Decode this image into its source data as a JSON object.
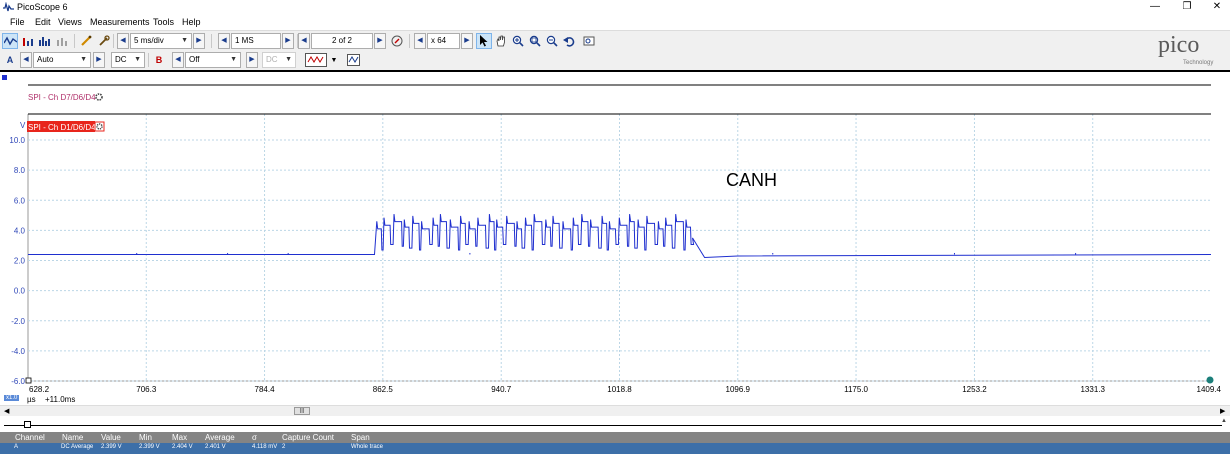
{
  "window": {
    "title": "PicoScope 6",
    "controls": {
      "minimize": "—",
      "maximize": "❐",
      "close": "✕"
    }
  },
  "menu": [
    "File",
    "Edit",
    "Views",
    "Measurements",
    "Tools",
    "Help"
  ],
  "toolbar1": {
    "timebase": "5 ms/div",
    "samples": "1 MS",
    "capture": "2 of 2",
    "zoom": "x 64"
  },
  "toolbar2": {
    "channel_a_label": "A",
    "range_a": "Auto",
    "coupling_a": "DC",
    "channel_b_label": "B",
    "range_b": "Off",
    "coupling_b": "DC"
  },
  "logo": {
    "main": "pico",
    "sub": "Technology"
  },
  "plot": {
    "decode_top_label": "SPI - Ch D7/D6/D4",
    "decode_bottom_label": "SPI - Ch D1/D6/D4",
    "y_unit": "V",
    "y_ticks": [
      "10.0",
      "8.0",
      "6.0",
      "4.0",
      "2.0",
      "0.0",
      "-2.0",
      "-4.0",
      "-6.0"
    ],
    "x_ticks": [
      "628.2",
      "706.3",
      "784.4",
      "862.5",
      "940.7",
      "1018.8",
      "1096.9",
      "1175.0",
      "1253.2",
      "1331.3",
      "1409.4"
    ],
    "annotation": "CANH",
    "trace_color": "#1f2fcf"
  },
  "status": {
    "scale": "x1.0",
    "unit": "µs",
    "offset": "+11.0ms"
  },
  "chart_data": {
    "type": "line",
    "title": "CANH",
    "xlabel": "µs",
    "ylabel": "V",
    "xlim": [
      628.2,
      1409.4
    ],
    "ylim": [
      -6.0,
      11.0
    ],
    "grid": true,
    "series": [
      {
        "x": [
          628.2,
          857.0,
          859.0,
          861.0,
          865.0,
          870.0,
          880.0,
          890.0,
          900.0,
          910.0,
          920.0,
          930.0,
          940.0,
          950.0,
          960.0,
          970.0,
          980.0,
          990.0,
          1000.0,
          1010.0,
          1020.0,
          1030.0,
          1040.0,
          1050.0,
          1060.0,
          1062.0,
          1064.0,
          1067.0,
          1075.0,
          1096.9,
          1409.4
        ],
        "values": [
          2.4,
          2.4,
          4.9,
          3.0,
          4.5,
          2.7,
          4.4,
          2.9,
          4.5,
          3.0,
          4.4,
          2.8,
          4.6,
          2.9,
          4.6,
          3.0,
          4.5,
          2.8,
          4.6,
          2.9,
          4.5,
          3.0,
          4.4,
          3.0,
          4.4,
          3.5,
          3.5,
          2.2,
          2.2,
          2.3,
          2.4
        ]
      }
    ]
  },
  "measurements": {
    "headers": [
      "Channel",
      "Name",
      "Value",
      "Min",
      "Max",
      "Average",
      "σ",
      "Capture Count",
      "Span"
    ],
    "rows": [
      [
        "A",
        "DC Average",
        "2.399 V",
        "2.399 V",
        "2.404 V",
        "2.401 V",
        "4.118 mV",
        "2",
        "Whole trace"
      ]
    ]
  }
}
